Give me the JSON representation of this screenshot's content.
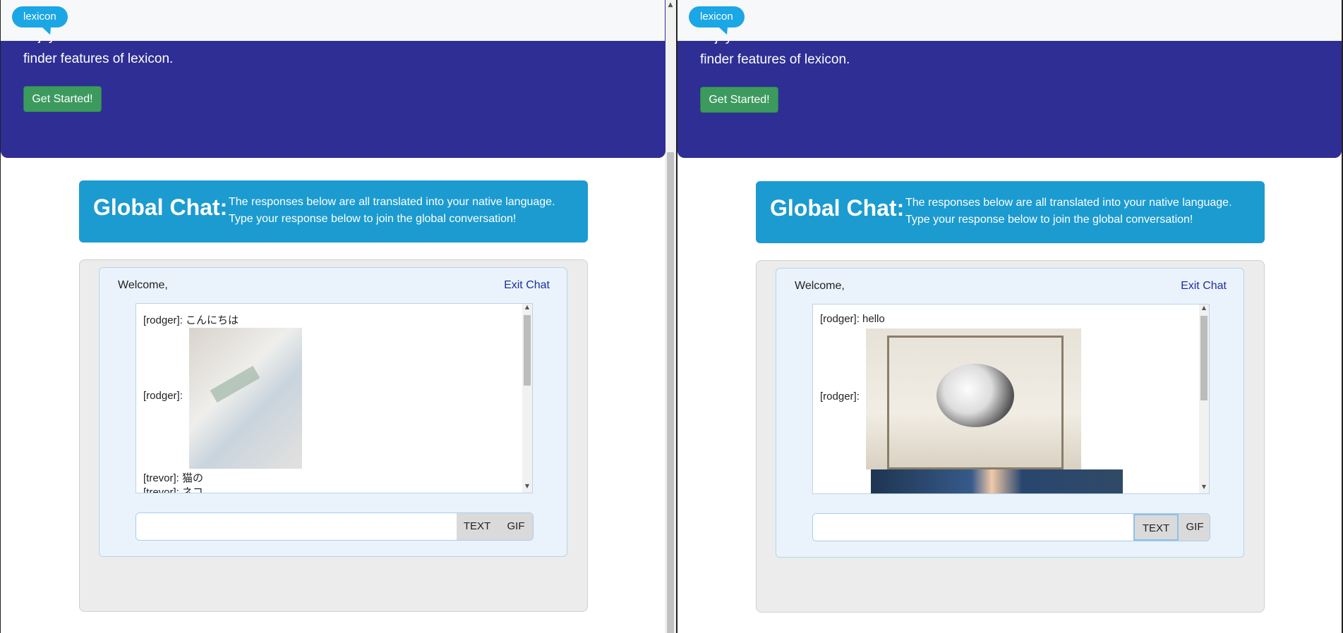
{
  "panes": [
    {
      "brand": "lexicon",
      "hero": {
        "partial_line": "enjoy the translation and friend",
        "line2": "finder features of lexicon.",
        "button": "Get Started!"
      },
      "banner": {
        "title": "Global Chat:",
        "sub1": "The responses below are all translated into your native language.",
        "sub2": "Type your response below to join the global conversation!"
      },
      "chat": {
        "welcome": "Welcome,",
        "exit": "Exit Chat",
        "messages": [
          {
            "text": "[rodger]: こんにちは"
          },
          {
            "text": "[rodger]:"
          },
          {
            "text": "[trevor]: 猫の"
          },
          {
            "text": "[trevor]: ネコ"
          }
        ],
        "input_value": "",
        "text_btn": "TEXT",
        "gif_btn": "GIF"
      }
    },
    {
      "brand": "lexicon",
      "hero": {
        "partial_line": "enjoy the translation and friend",
        "line2": "finder features of lexicon.",
        "button": "Get Started!"
      },
      "banner": {
        "title": "Global Chat:",
        "sub1": "The responses below are all translated into your native language.",
        "sub2": "Type your response below to join the global conversation!"
      },
      "chat": {
        "welcome": "Welcome,",
        "exit": "Exit Chat",
        "messages": [
          {
            "text": "[rodger]: hello"
          },
          {
            "text": "[rodger]:"
          }
        ],
        "input_value": "",
        "text_btn": "TEXT",
        "gif_btn": "GIF"
      }
    }
  ],
  "colors": {
    "hero_bg": "#2e2e94",
    "banner_bg": "#1b9bd0",
    "button_green": "#3c9a5f",
    "brand_blue": "#1ba6e5",
    "link": "#1f2ea0"
  }
}
